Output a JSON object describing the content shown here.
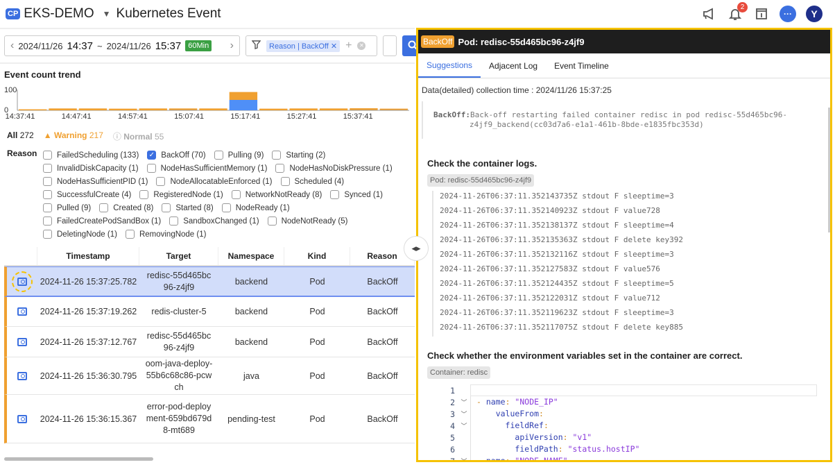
{
  "header": {
    "badge": "CP",
    "project": "EKS-DEMO",
    "title": "Kubernetes Event",
    "notification_count": "2",
    "avatar_letter": "Y",
    "icons": [
      "megaphone-icon",
      "bell-icon",
      "info-panel-icon",
      "chat-icon"
    ]
  },
  "toolbar": {
    "date_from": "2024/11/26",
    "time_from": "14:37",
    "sep": "~",
    "date_to": "2024/11/26",
    "time_to": "15:37",
    "range_badge": "60Min",
    "filter_chip": "Reason | BackOff",
    "prev": "‹",
    "next": "›"
  },
  "trend": {
    "title": "Event count trend"
  },
  "chart_data": {
    "type": "bar",
    "stacked": true,
    "title": "",
    "ylim": [
      0,
      100
    ],
    "yticks": [
      "100",
      "0"
    ],
    "x_ticks": [
      "14:37:41",
      "14:47:41",
      "14:57:41",
      "15:07:41",
      "15:17:41",
      "15:27:41",
      "15:37:41"
    ],
    "series": [
      {
        "name": "Normal",
        "color": "#4f8ff7",
        "values": [
          0,
          0,
          0,
          0,
          0,
          1,
          0,
          50,
          0,
          0,
          0,
          1,
          1
        ]
      },
      {
        "name": "Warning",
        "color": "#f0a030",
        "values": [
          5,
          9,
          9,
          8,
          9,
          8,
          9,
          38,
          8,
          9,
          9,
          9,
          7
        ]
      }
    ]
  },
  "counts": {
    "all_label": "All",
    "all": "272",
    "warning_label": "Warning",
    "warning": "217",
    "normal_label": "Normal",
    "normal": "55",
    "colors": {
      "warning": "#f0a030",
      "normal": "#aaaaaa"
    }
  },
  "reason": {
    "label": "Reason",
    "rows": [
      [
        {
          "t": "FailedScheduling (133)",
          "c": false
        },
        {
          "t": "BackOff (70)",
          "c": true
        },
        {
          "t": "Pulling (9)",
          "c": false
        },
        {
          "t": "Starting (2)",
          "c": false
        }
      ],
      [
        {
          "t": "InvalidDiskCapacity (1)",
          "c": false
        },
        {
          "t": "NodeHasSufficientMemory (1)",
          "c": false
        },
        {
          "t": "NodeHasNoDiskPressure (1)",
          "c": false
        }
      ],
      [
        {
          "t": "NodeHasSufficientPID (1)",
          "c": false
        },
        {
          "t": "NodeAllocatableEnforced (1)",
          "c": false
        },
        {
          "t": "Scheduled (4)",
          "c": false
        }
      ],
      [
        {
          "t": "SuccessfulCreate (4)",
          "c": false
        },
        {
          "t": "RegisteredNode (1)",
          "c": false
        },
        {
          "t": "NetworkNotReady (8)",
          "c": false
        },
        {
          "t": "Synced (1)",
          "c": false
        }
      ],
      [
        {
          "t": "Pulled (9)",
          "c": false
        },
        {
          "t": "Created (8)",
          "c": false
        },
        {
          "t": "Started (8)",
          "c": false
        },
        {
          "t": "NodeReady (1)",
          "c": false
        }
      ],
      [
        {
          "t": "FailedCreatePodSandBox (1)",
          "c": false
        },
        {
          "t": "SandboxChanged (1)",
          "c": false
        },
        {
          "t": "NodeNotReady (5)",
          "c": false
        }
      ],
      [
        {
          "t": "DeletingNode (1)",
          "c": false
        },
        {
          "t": "RemovingNode (1)",
          "c": false
        }
      ]
    ]
  },
  "table": {
    "columns": [
      "",
      "Timestamp",
      "Target",
      "Namespace",
      "Kind",
      "Reason"
    ],
    "rows": [
      {
        "ts": "2024-11-26 15:37:25.782",
        "target": "redisc-55d465bc96-z4jf9",
        "ns": "backend",
        "kind": "Pod",
        "reason": "BackOff",
        "selected": true
      },
      {
        "ts": "2024-11-26 15:37:19.262",
        "target": "redis-cluster-5",
        "ns": "backend",
        "kind": "Pod",
        "reason": "BackOff"
      },
      {
        "ts": "2024-11-26 15:37:12.767",
        "target": "redisc-55d465bc96-z4jf9",
        "ns": "backend",
        "kind": "Pod",
        "reason": "BackOff"
      },
      {
        "ts": "2024-11-26 15:36:30.795",
        "target": "oom-java-deploy-55b6c68c86-pcwch",
        "ns": "java",
        "kind": "Pod",
        "reason": "BackOff"
      },
      {
        "ts": "2024-11-26 15:36:15.367",
        "target": "error-pod-deployment-659bd679d8-mt689",
        "ns": "pending-test",
        "kind": "Pod",
        "reason": "BackOff"
      }
    ]
  },
  "panel": {
    "badge": "BackOff",
    "title": "Pod: redisc-55d465bc96-z4jf9",
    "tabs": [
      "Suggestions",
      "Adjacent Log",
      "Event Timeline"
    ],
    "collection_time": "Data(detailed) collection time : 2024/11/26 15:37:25",
    "message_reason": "BackOff:",
    "message_l1": "Back-off restarting failed container redisc in pod redisc-55d465bc96-",
    "message_l2": "z4jf9_backend(cc03d7a6-e1a1-461b-8bde-e1835fbc353d)",
    "logs_heading": "Check the container logs.",
    "logs_tag": "Pod: redisc-55d465bc96-z4jf9",
    "logs": [
      "2024-11-26T06:37:11.352143735Z stdout F sleeptime=3",
      "2024-11-26T06:37:11.352140923Z stdout F value728",
      "2024-11-26T06:37:11.352138137Z stdout F sleeptime=4",
      "2024-11-26T06:37:11.352135363Z stdout F delete key392",
      "2024-11-26T06:37:11.352132116Z stdout F sleeptime=3",
      "2024-11-26T06:37:11.352127583Z stdout F value576",
      "2024-11-26T06:37:11.352124435Z stdout F sleeptime=5",
      "2024-11-26T06:37:11.352122031Z stdout F value712",
      "2024-11-26T06:37:11.352119623Z stdout F sleeptime=3",
      "2024-11-26T06:37:11.352117075Z stdout F delete key885"
    ],
    "env_heading": "Check whether the environment variables set in the container are correct.",
    "env_tag": "Container: redisc",
    "code": [
      {
        "n": "1",
        "fold": false,
        "indent": 0,
        "dash": false,
        "key": "",
        "val": ""
      },
      {
        "n": "2",
        "fold": true,
        "indent": 0,
        "dash": true,
        "key": "name",
        "val": "\"NODE_IP\""
      },
      {
        "n": "3",
        "fold": true,
        "indent": 1,
        "dash": false,
        "key": "valueFrom",
        "val": ""
      },
      {
        "n": "4",
        "fold": true,
        "indent": 2,
        "dash": false,
        "key": "fieldRef",
        "val": ""
      },
      {
        "n": "5",
        "fold": false,
        "indent": 3,
        "dash": false,
        "key": "apiVersion",
        "val": "\"v1\""
      },
      {
        "n": "6",
        "fold": false,
        "indent": 3,
        "dash": false,
        "key": "fieldPath",
        "val": "\"status.hostIP\""
      },
      {
        "n": "7",
        "fold": true,
        "indent": 0,
        "dash": true,
        "key": "name",
        "val": "\"NODE_NAME\""
      }
    ]
  }
}
